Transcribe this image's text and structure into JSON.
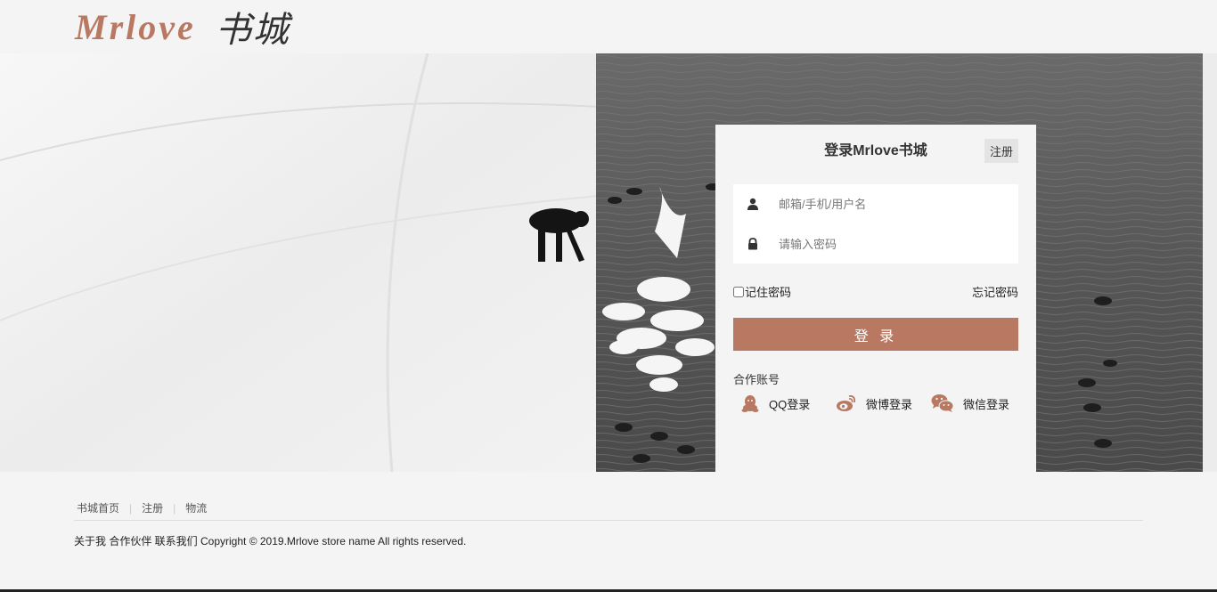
{
  "header": {
    "brand": "Mrlove",
    "brand_cn": "书城"
  },
  "login": {
    "title": "登录Mrlove书城",
    "register_label": "注册",
    "username_placeholder": "邮箱/手机/用户名",
    "password_placeholder": "请输入密码",
    "remember_label": "记住密码",
    "forgot_label": "忘记密码",
    "submit_label": "登 录",
    "partner_label": "合作账号",
    "social": [
      {
        "label": "QQ登录",
        "icon": "qq-icon"
      },
      {
        "label": "微博登录",
        "icon": "weibo-icon"
      },
      {
        "label": "微信登录",
        "icon": "wechat-icon"
      }
    ]
  },
  "footer": {
    "nav": [
      {
        "label": "书城首页"
      },
      {
        "label": "注册"
      },
      {
        "label": "物流"
      }
    ],
    "copyright": "关于我 合作伙伴 联系我们 Copyright © 2019.Mrlove store name All rights reserved."
  },
  "colors": {
    "accent": "#b87861",
    "background": "#f4f4f4"
  }
}
